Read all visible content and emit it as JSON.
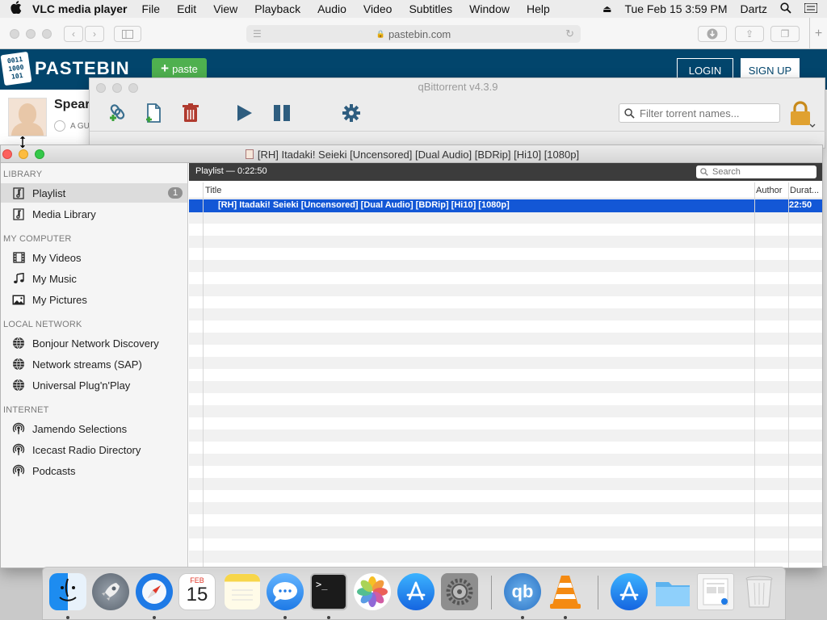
{
  "menubar": {
    "app_name": "VLC media player",
    "menus": [
      "File",
      "Edit",
      "View",
      "Playback",
      "Audio",
      "Video",
      "Subtitles",
      "Window",
      "Help"
    ],
    "clock": "Tue Feb 15  3:59 PM",
    "user": "Dartz"
  },
  "safari": {
    "url": "pastebin.com"
  },
  "pastebin": {
    "logo_text": "PASTEBIN",
    "logo_digits": "0011\n1000\n101",
    "paste_label": "paste",
    "login_label": "LOGIN",
    "signup_label": "SIGN UP",
    "username": "Spear",
    "guest": "A GU"
  },
  "qbittorrent": {
    "title": "qBittorrent v4.3.9",
    "filter_placeholder": "Filter torrent names..."
  },
  "vlc": {
    "window_title": "[RH] Itadaki! Seieki [Uncensored] [Dual Audio] [BDRip] [Hi10] [1080p]",
    "sidebar": {
      "sections": [
        {
          "title": "LIBRARY",
          "items": [
            {
              "label": "Playlist",
              "icon": "playlist-icon",
              "badge": "1",
              "active": true
            },
            {
              "label": "Media Library",
              "icon": "media-library-icon"
            }
          ]
        },
        {
          "title": "MY COMPUTER",
          "items": [
            {
              "label": "My Videos",
              "icon": "film-icon"
            },
            {
              "label": "My Music",
              "icon": "music-note-icon"
            },
            {
              "label": "My Pictures",
              "icon": "picture-icon"
            }
          ]
        },
        {
          "title": "LOCAL NETWORK",
          "items": [
            {
              "label": "Bonjour Network Discovery",
              "icon": "network-globe-icon"
            },
            {
              "label": "Network streams (SAP)",
              "icon": "network-globe-icon"
            },
            {
              "label": "Universal Plug'n'Play",
              "icon": "network-globe-icon"
            }
          ]
        },
        {
          "title": "INTERNET",
          "items": [
            {
              "label": "Jamendo Selections",
              "icon": "podcast-icon"
            },
            {
              "label": "Icecast Radio Directory",
              "icon": "podcast-icon"
            },
            {
              "label": "Podcasts",
              "icon": "podcast-icon"
            }
          ]
        }
      ]
    },
    "playlist": {
      "header": "Playlist — 0:22:50",
      "search_placeholder": "Search",
      "columns": {
        "title": "Title",
        "author": "Author",
        "duration": "Durat..."
      },
      "rows": [
        {
          "title": "[RH] Itadaki! Seieki [Uncensored] [Dual Audio] [BDRip] [Hi10] [1080p]",
          "author": "",
          "duration": "22:50",
          "selected": true
        }
      ]
    }
  },
  "dock": {
    "calendar_month": "FEB",
    "calendar_day": "15",
    "qb_label": "qb",
    "terminal_prompt": ">_"
  },
  "colors": {
    "pastebin_blue": "#02456c",
    "selection_blue": "#1357d6",
    "paste_green": "#4fb04f"
  }
}
